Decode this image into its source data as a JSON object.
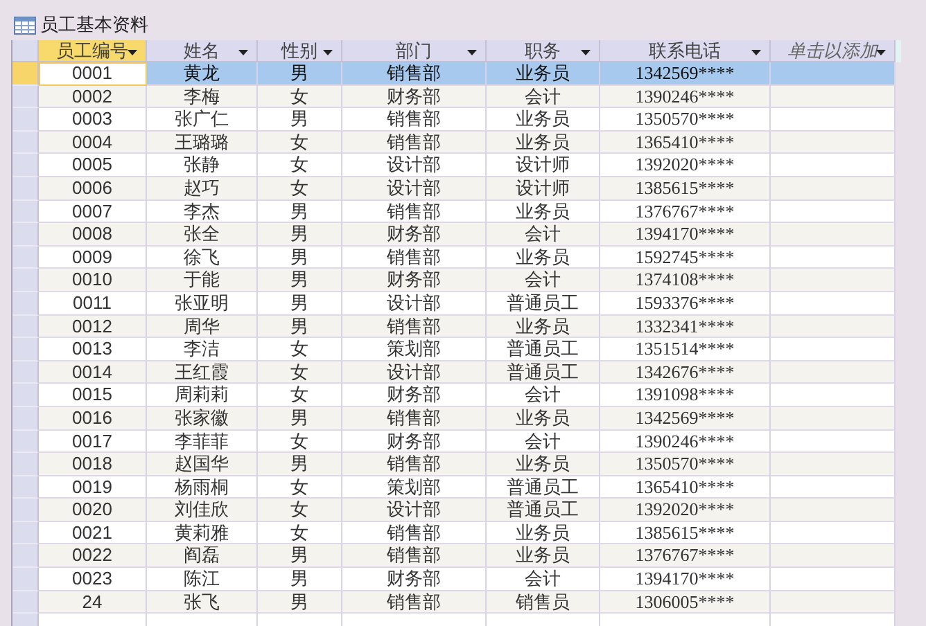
{
  "tab": {
    "title": "员工基本资料"
  },
  "table": {
    "columns": [
      {
        "label": "员工编号",
        "selected": true,
        "kind": "field"
      },
      {
        "label": "姓名",
        "selected": false,
        "kind": "field"
      },
      {
        "label": "性别",
        "selected": false,
        "kind": "field"
      },
      {
        "label": "部门",
        "selected": false,
        "kind": "field"
      },
      {
        "label": "职务",
        "selected": false,
        "kind": "field"
      },
      {
        "label": "联系电话",
        "selected": false,
        "kind": "field"
      },
      {
        "label": "单击以添加",
        "selected": false,
        "kind": "add"
      }
    ],
    "rows": [
      {
        "selected": true,
        "cells": [
          "0001",
          "黄龙",
          "男",
          "销售部",
          "业务员",
          "1342569****"
        ]
      },
      {
        "selected": false,
        "cells": [
          "0002",
          "李梅",
          "女",
          "财务部",
          "会计",
          "1390246****"
        ]
      },
      {
        "selected": false,
        "cells": [
          "0003",
          "张广仁",
          "男",
          "销售部",
          "业务员",
          "1350570****"
        ]
      },
      {
        "selected": false,
        "cells": [
          "0004",
          "王璐璐",
          "女",
          "销售部",
          "业务员",
          "1365410****"
        ]
      },
      {
        "selected": false,
        "cells": [
          "0005",
          "张静",
          "女",
          "设计部",
          "设计师",
          "1392020****"
        ]
      },
      {
        "selected": false,
        "cells": [
          "0006",
          "赵巧",
          "女",
          "设计部",
          "设计师",
          "1385615****"
        ]
      },
      {
        "selected": false,
        "cells": [
          "0007",
          "李杰",
          "男",
          "销售部",
          "业务员",
          "1376767****"
        ]
      },
      {
        "selected": false,
        "cells": [
          "0008",
          "张全",
          "男",
          "财务部",
          "会计",
          "1394170****"
        ]
      },
      {
        "selected": false,
        "cells": [
          "0009",
          "徐飞",
          "男",
          "销售部",
          "业务员",
          "1592745****"
        ]
      },
      {
        "selected": false,
        "cells": [
          "0010",
          "于能",
          "男",
          "财务部",
          "会计",
          "1374108****"
        ]
      },
      {
        "selected": false,
        "cells": [
          "0011",
          "张亚明",
          "男",
          "设计部",
          "普通员工",
          "1593376****"
        ]
      },
      {
        "selected": false,
        "cells": [
          "0012",
          "周华",
          "男",
          "销售部",
          "业务员",
          "1332341****"
        ]
      },
      {
        "selected": false,
        "cells": [
          "0013",
          "李洁",
          "女",
          "策划部",
          "普通员工",
          "1351514****"
        ]
      },
      {
        "selected": false,
        "cells": [
          "0014",
          "王红霞",
          "女",
          "设计部",
          "普通员工",
          "1342676****"
        ]
      },
      {
        "selected": false,
        "cells": [
          "0015",
          "周莉莉",
          "女",
          "财务部",
          "会计",
          "1391098****"
        ]
      },
      {
        "selected": false,
        "cells": [
          "0016",
          "张家徽",
          "男",
          "销售部",
          "业务员",
          "1342569****"
        ]
      },
      {
        "selected": false,
        "cells": [
          "0017",
          "李菲菲",
          "女",
          "财务部",
          "会计",
          "1390246****"
        ]
      },
      {
        "selected": false,
        "cells": [
          "0018",
          "赵国华",
          "男",
          "销售部",
          "业务员",
          "1350570****"
        ]
      },
      {
        "selected": false,
        "cells": [
          "0019",
          "杨雨桐",
          "女",
          "策划部",
          "普通员工",
          "1365410****"
        ]
      },
      {
        "selected": false,
        "cells": [
          "0020",
          "刘佳欣",
          "女",
          "设计部",
          "普通员工",
          "1392020****"
        ]
      },
      {
        "selected": false,
        "cells": [
          "0021",
          "黄莉雅",
          "女",
          "销售部",
          "业务员",
          "1385615****"
        ]
      },
      {
        "selected": false,
        "cells": [
          "0022",
          "阎磊",
          "男",
          "销售部",
          "业务员",
          "1376767****"
        ]
      },
      {
        "selected": false,
        "cells": [
          "0023",
          "陈江",
          "男",
          "财务部",
          "会计",
          "1394170****"
        ]
      },
      {
        "selected": false,
        "cells": [
          "24",
          "张飞",
          "男",
          "销售部",
          "销售员",
          "1306005****"
        ]
      }
    ]
  }
}
